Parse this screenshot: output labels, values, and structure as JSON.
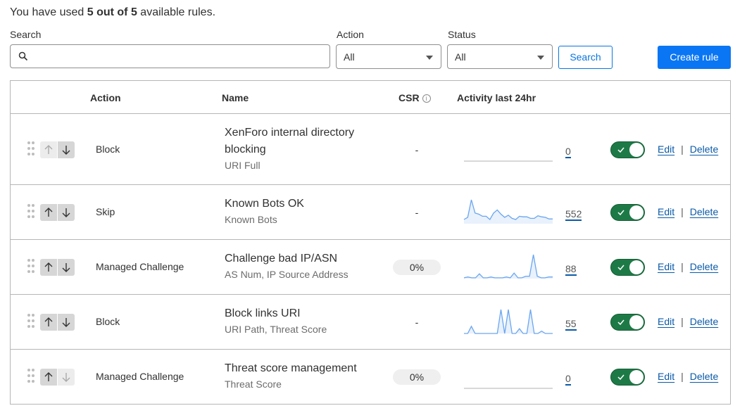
{
  "usage": {
    "prefix": "You have used",
    "count": "5 out of 5",
    "suffix": "available rules."
  },
  "filters": {
    "search_label": "Search",
    "search_placeholder": "",
    "search_value": "",
    "action_label": "Action",
    "action_value": "All",
    "status_label": "Status",
    "status_value": "All",
    "search_button": "Search",
    "create_button": "Create rule"
  },
  "table": {
    "headers": {
      "action": "Action",
      "name": "Name",
      "csr": "CSR",
      "csr_info_icon": "i",
      "activity": "Activity last 24hr"
    },
    "rows": [
      {
        "action": "Block",
        "name": "XenForo internal directory blocking",
        "fields": "URI Full",
        "csr": "-",
        "activity_count": "0",
        "activity_series": [
          0,
          0,
          0,
          0,
          0,
          0,
          0,
          0,
          0,
          0,
          0,
          0,
          0,
          0,
          0,
          0,
          0,
          0,
          0,
          0,
          0,
          0,
          0,
          0
        ],
        "enabled": true,
        "up_enabled": false,
        "down_enabled": true,
        "edit": "Edit",
        "delete": "Delete"
      },
      {
        "action": "Skip",
        "name": "Known Bots OK",
        "fields": "Known Bots",
        "csr": "-",
        "activity_count": "552",
        "activity_series": [
          8,
          12,
          45,
          20,
          18,
          14,
          14,
          8,
          20,
          26,
          18,
          12,
          16,
          10,
          8,
          14,
          13,
          13,
          10,
          10,
          15,
          13,
          12,
          9,
          9
        ],
        "enabled": true,
        "up_enabled": true,
        "down_enabled": true,
        "edit": "Edit",
        "delete": "Delete"
      },
      {
        "action": "Managed Challenge",
        "name": "Challenge bad IP/ASN",
        "fields": "AS Num, IP Source Address",
        "csr": "0%",
        "activity_count": "88",
        "activity_series": [
          1,
          2,
          1,
          1,
          6,
          1,
          1,
          2,
          1,
          1,
          1,
          2,
          1,
          7,
          1,
          1,
          3,
          3,
          30,
          3,
          1,
          1,
          2,
          2
        ],
        "enabled": true,
        "up_enabled": true,
        "down_enabled": true,
        "edit": "Edit",
        "delete": "Delete"
      },
      {
        "action": "Block",
        "name": "Block links URI",
        "fields": "URI Path, Threat Score",
        "csr": "-",
        "activity_count": "55",
        "activity_series": [
          0,
          0,
          3,
          0,
          0,
          0,
          0,
          0,
          0,
          0,
          10,
          0,
          10,
          0,
          0,
          2,
          0,
          0,
          10,
          0,
          0,
          1,
          0,
          0,
          0
        ],
        "enabled": true,
        "up_enabled": true,
        "down_enabled": true,
        "edit": "Edit",
        "delete": "Delete"
      },
      {
        "action": "Managed Challenge",
        "name": "Threat score management",
        "fields": "Threat Score",
        "csr": "0%",
        "activity_count": "0",
        "activity_series": [
          0,
          0,
          0,
          0,
          0,
          0,
          0,
          0,
          0,
          0,
          0,
          0,
          0,
          0,
          0,
          0,
          0,
          0,
          0,
          0,
          0,
          0,
          0,
          0
        ],
        "enabled": true,
        "up_enabled": true,
        "down_enabled": false,
        "edit": "Edit",
        "delete": "Delete"
      }
    ]
  },
  "colors": {
    "primary": "#0a76f4",
    "link": "#0a5aa8",
    "toggle_on": "#1d7a46",
    "spark_line": "#6aa6f0",
    "spark_fill": "#e8f1fc",
    "spark_empty": "#d8d8d8"
  }
}
